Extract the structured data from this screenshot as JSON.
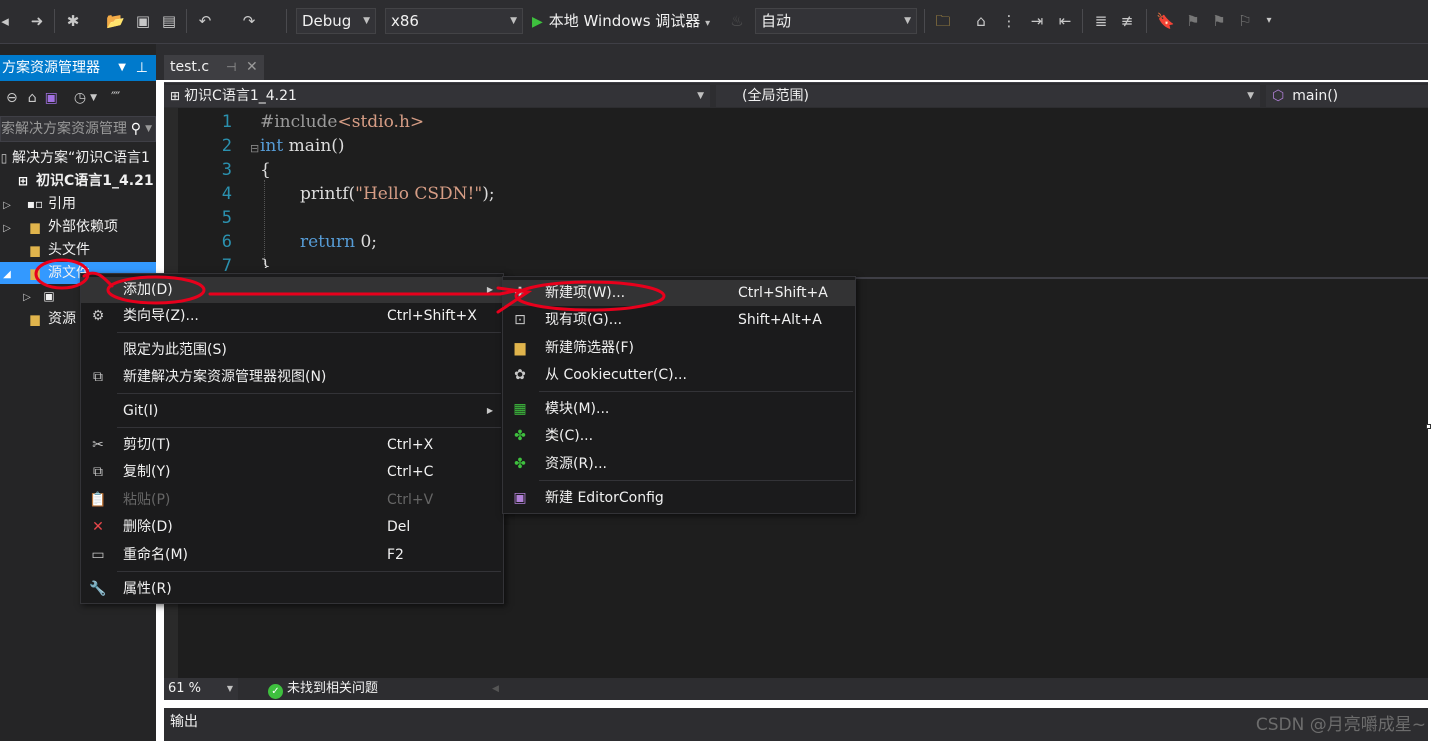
{
  "toolbar": {
    "config": "Debug",
    "platform": "x86",
    "run_label": "本地 Windows 调试器",
    "run_dropdown": "▾",
    "auto": "自动"
  },
  "solution_explorer": {
    "title": "方案资源管理器",
    "search_placeholder": "索解决方案资源管理",
    "items": [
      {
        "label": "解决方案“初识C语言1"
      },
      {
        "label": "初识C语言1_4.21"
      },
      {
        "label": "引用"
      },
      {
        "label": "外部依赖项"
      },
      {
        "label": "头文件"
      },
      {
        "label": "源文件"
      },
      {
        "label": "资源"
      }
    ]
  },
  "editor": {
    "tab_label": "test.c",
    "nav_project": "初识C语言1_4.21",
    "nav_scope": "(全局范围)",
    "nav_member": "main()",
    "line_numbers": [
      "1",
      "2",
      "3",
      "4",
      "5",
      "6",
      "7"
    ],
    "code": {
      "l1_directive": "#include",
      "l1_header": "<stdio.h>",
      "l2_type": "int",
      "l2_name": " main()",
      "l3": "{",
      "l4_fn": "printf(",
      "l4_str": "\"Hello CSDN!\"",
      "l4_end": ");",
      "l6_kw": "return",
      "l6_rest": " 0;",
      "l7": "}"
    }
  },
  "status": {
    "zoom": "61 %",
    "issues": "未找到相关问题"
  },
  "output_label": "输出",
  "context_menu": {
    "items": [
      {
        "label": "添加(D)",
        "key": ""
      },
      {
        "label": "类向导(Z)...",
        "key": "Ctrl+Shift+X"
      },
      {
        "label": "限定为此范围(S)",
        "key": ""
      },
      {
        "label": "新建解决方案资源管理器视图(N)",
        "key": ""
      },
      {
        "label": "Git(I)",
        "key": ""
      },
      {
        "label": "剪切(T)",
        "key": "Ctrl+X"
      },
      {
        "label": "复制(Y)",
        "key": "Ctrl+C"
      },
      {
        "label": "粘贴(P)",
        "key": "Ctrl+V"
      },
      {
        "label": "删除(D)",
        "key": "Del"
      },
      {
        "label": "重命名(M)",
        "key": "F2"
      },
      {
        "label": "属性(R)",
        "key": ""
      }
    ]
  },
  "submenu": {
    "items": [
      {
        "label": "新建项(W)...",
        "key": "Ctrl+Shift+A"
      },
      {
        "label": "现有项(G)...",
        "key": "Shift+Alt+A"
      },
      {
        "label": "新建筛选器(F)",
        "key": ""
      },
      {
        "label": "从 Cookiecutter(C)...",
        "key": ""
      },
      {
        "label": "模块(M)...",
        "key": ""
      },
      {
        "label": "类(C)...",
        "key": ""
      },
      {
        "label": "资源(R)...",
        "key": ""
      },
      {
        "label": "新建 EditorConfig",
        "key": ""
      }
    ]
  },
  "watermark": "CSDN @月亮嚼成星~",
  "colors": {
    "accent": "#007acc",
    "annotation": "#e8001c",
    "selection": "#3399ff"
  }
}
